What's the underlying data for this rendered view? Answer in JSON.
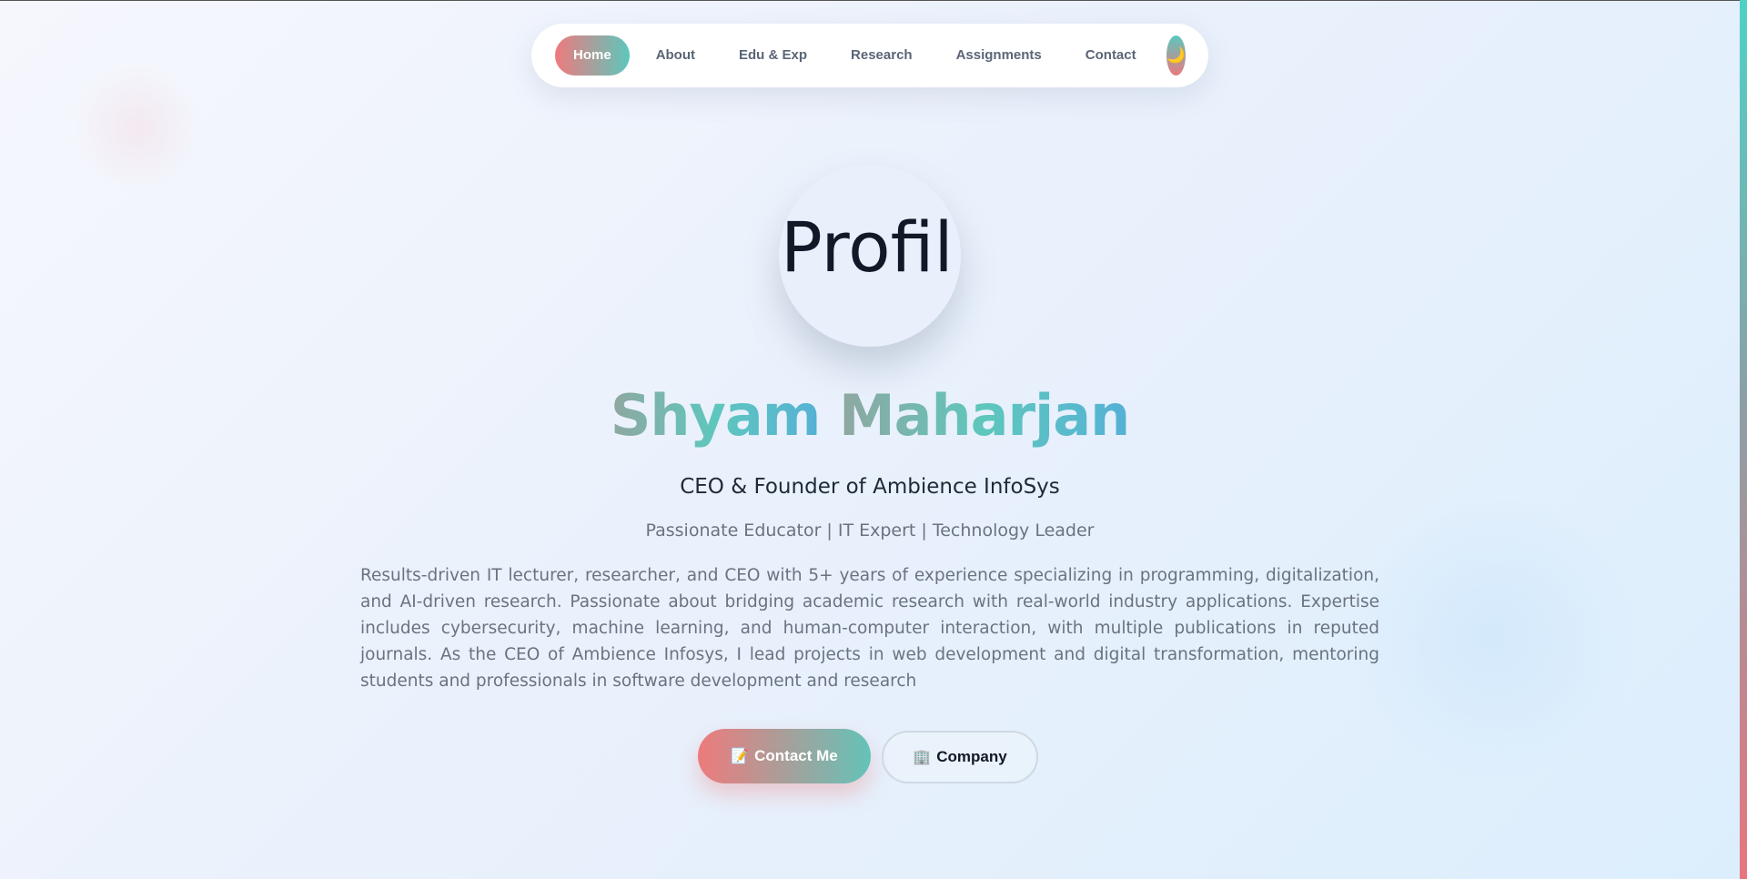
{
  "nav": {
    "items": [
      {
        "label": "Home",
        "active": true
      },
      {
        "label": "About"
      },
      {
        "label": "Edu & Exp"
      },
      {
        "label": "Research"
      },
      {
        "label": "Assignments"
      },
      {
        "label": "Contact"
      }
    ],
    "theme_toggle_icon": "moon-icon",
    "theme_toggle_glyph": "🌙"
  },
  "avatar": {
    "alt_text": "Profil"
  },
  "hero": {
    "first_name": "Shyam",
    "last_name": "Maharjan",
    "role": "CEO & Founder of Ambience InfoSys",
    "tagline": "Passionate Educator | IT Expert | Technology Leader",
    "bio": "Results-driven IT lecturer, researcher, and CEO with 5+ years of experience specializing in programming, digitalization, and AI-driven research. Passionate about bridging academic research with real-world industry applications. Expertise includes cybersecurity, machine learning, and human-computer interaction, with multiple publications in reputed journals. As the CEO of Ambience Infosys, I lead projects in web development and digital transformation, mentoring students and professionals in software development and research"
  },
  "buttons": {
    "contact": {
      "icon": "memo-icon",
      "glyph": "📝",
      "label": "Contact Me"
    },
    "company": {
      "icon": "office-building-icon",
      "glyph": "🏢",
      "label": "Company"
    }
  },
  "colors": {
    "accent_coral": "#ef7a7d",
    "accent_teal": "#5cc7bd",
    "accent_blue": "#56b1d6"
  }
}
